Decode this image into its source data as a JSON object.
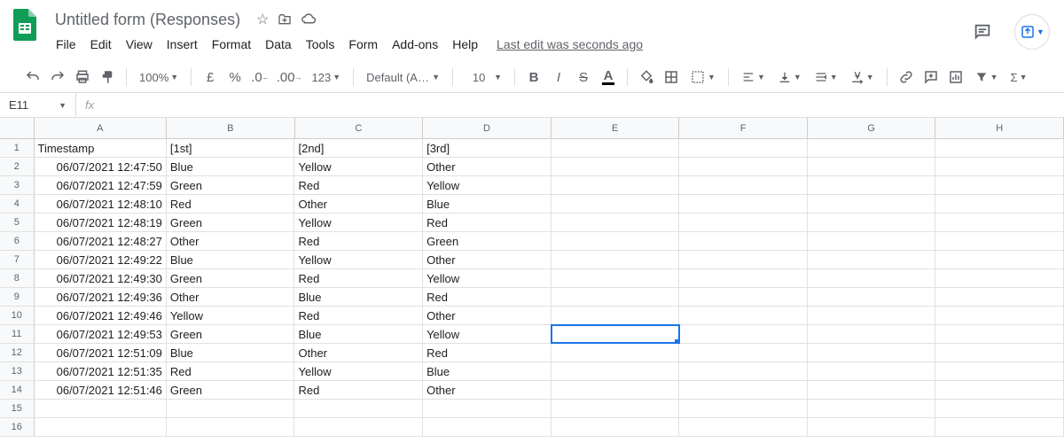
{
  "doc": {
    "title": "Untitled form (Responses)",
    "last_edit": "Last edit was seconds ago"
  },
  "menus": [
    "File",
    "Edit",
    "View",
    "Insert",
    "Format",
    "Data",
    "Tools",
    "Form",
    "Add-ons",
    "Help"
  ],
  "toolbar": {
    "zoom": "100%",
    "font": "Default (Ari...",
    "size": "10"
  },
  "name_box": "E11",
  "formula": "",
  "columns": [
    "A",
    "B",
    "C",
    "D",
    "E",
    "F",
    "G",
    "H"
  ],
  "selected": {
    "row": 11,
    "col": 4
  },
  "rows": [
    {
      "ts": "Timestamp",
      "c1": "[1st]",
      "c2": "[2nd]",
      "c3": "[3rd]",
      "hdr": true
    },
    {
      "ts": "06/07/2021 12:47:50",
      "c1": "Blue",
      "c2": "Yellow",
      "c3": "Other"
    },
    {
      "ts": "06/07/2021 12:47:59",
      "c1": "Green",
      "c2": "Red",
      "c3": "Yellow"
    },
    {
      "ts": "06/07/2021 12:48:10",
      "c1": "Red",
      "c2": "Other",
      "c3": "Blue"
    },
    {
      "ts": "06/07/2021 12:48:19",
      "c1": "Green",
      "c2": "Yellow",
      "c3": "Red"
    },
    {
      "ts": "06/07/2021 12:48:27",
      "c1": "Other",
      "c2": "Red",
      "c3": "Green"
    },
    {
      "ts": "06/07/2021 12:49:22",
      "c1": "Blue",
      "c2": "Yellow",
      "c3": "Other"
    },
    {
      "ts": "06/07/2021 12:49:30",
      "c1": "Green",
      "c2": "Red",
      "c3": "Yellow"
    },
    {
      "ts": "06/07/2021 12:49:36",
      "c1": "Other",
      "c2": "Blue",
      "c3": "Red"
    },
    {
      "ts": "06/07/2021 12:49:46",
      "c1": "Yellow",
      "c2": "Red",
      "c3": "Other"
    },
    {
      "ts": "06/07/2021 12:49:53",
      "c1": "Green",
      "c2": "Blue",
      "c3": "Yellow"
    },
    {
      "ts": "06/07/2021 12:51:09",
      "c1": "Blue",
      "c2": "Other",
      "c3": "Red"
    },
    {
      "ts": "06/07/2021 12:51:35",
      "c1": "Red",
      "c2": "Yellow",
      "c3": "Blue"
    },
    {
      "ts": "06/07/2021 12:51:46",
      "c1": "Green",
      "c2": "Red",
      "c3": "Other"
    }
  ],
  "blank_rows": 2
}
